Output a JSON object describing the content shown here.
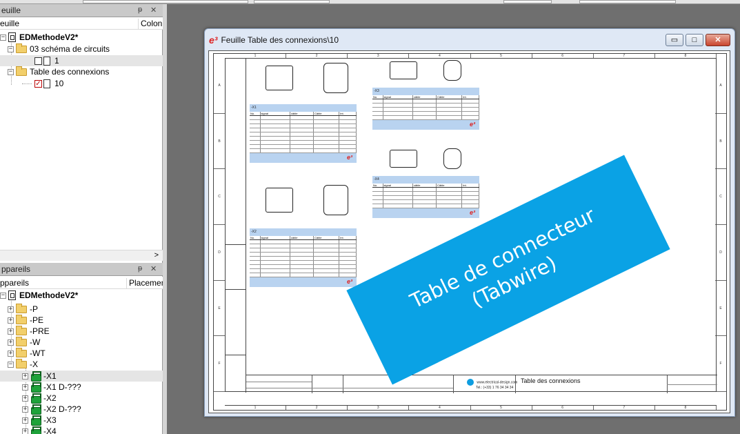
{
  "feuille_panel": {
    "title": "euille",
    "col_name": "euille",
    "col_other": "Colonn",
    "tree": {
      "root": "EDMethodeV2*",
      "nodes": [
        {
          "label": "03 schéma de circuits",
          "child": "1",
          "checked": false
        },
        {
          "label": "Table des connexions",
          "child": "10",
          "checked": true
        }
      ]
    },
    "scroll_arrow": ">"
  },
  "appareils_panel": {
    "title": "ppareils",
    "col_name": "ppareils",
    "col_other": "Placemen",
    "tree": {
      "root": "EDMethodeV2*",
      "folders": [
        "-P",
        "-PE",
        "-PRE",
        "-W",
        "-WT",
        "-X"
      ],
      "devices": [
        "-X1",
        "-X1 D-???",
        "-X2",
        "-X2 D-???",
        "-X3",
        "-X4"
      ]
    }
  },
  "panel_controls": {
    "pin": "ᵽ",
    "close": "✕"
  },
  "window": {
    "logo": "e³",
    "title": "Feuille Table des connexions\\10",
    "btn_min": "▭",
    "btn_max": "□",
    "btn_close": "✕"
  },
  "sheet": {
    "cols": [
      "1",
      "2",
      "3",
      "4",
      "5",
      "6",
      "7",
      "8"
    ],
    "rows": [
      "A",
      "B",
      "C",
      "D",
      "E",
      "F"
    ],
    "tables": [
      {
        "name": "-X1",
        "rows": 9
      },
      {
        "name": "-X2",
        "rows": 9
      },
      {
        "name": "-X3",
        "rows": 5
      },
      {
        "name": "-X4",
        "rows": 5
      }
    ],
    "table_columns": [
      "No.",
      "signal",
      "câble",
      "Câble",
      "Int."
    ],
    "title_block": {
      "title": "Table des connexions",
      "website": "www.electrical-design.com",
      "phone": "Tel.: (+33) 1 76 34 34 34"
    }
  },
  "banner": {
    "line1": "Table de connecteur",
    "line2": "(Tabwire)",
    "color": "#0aa2e5"
  }
}
